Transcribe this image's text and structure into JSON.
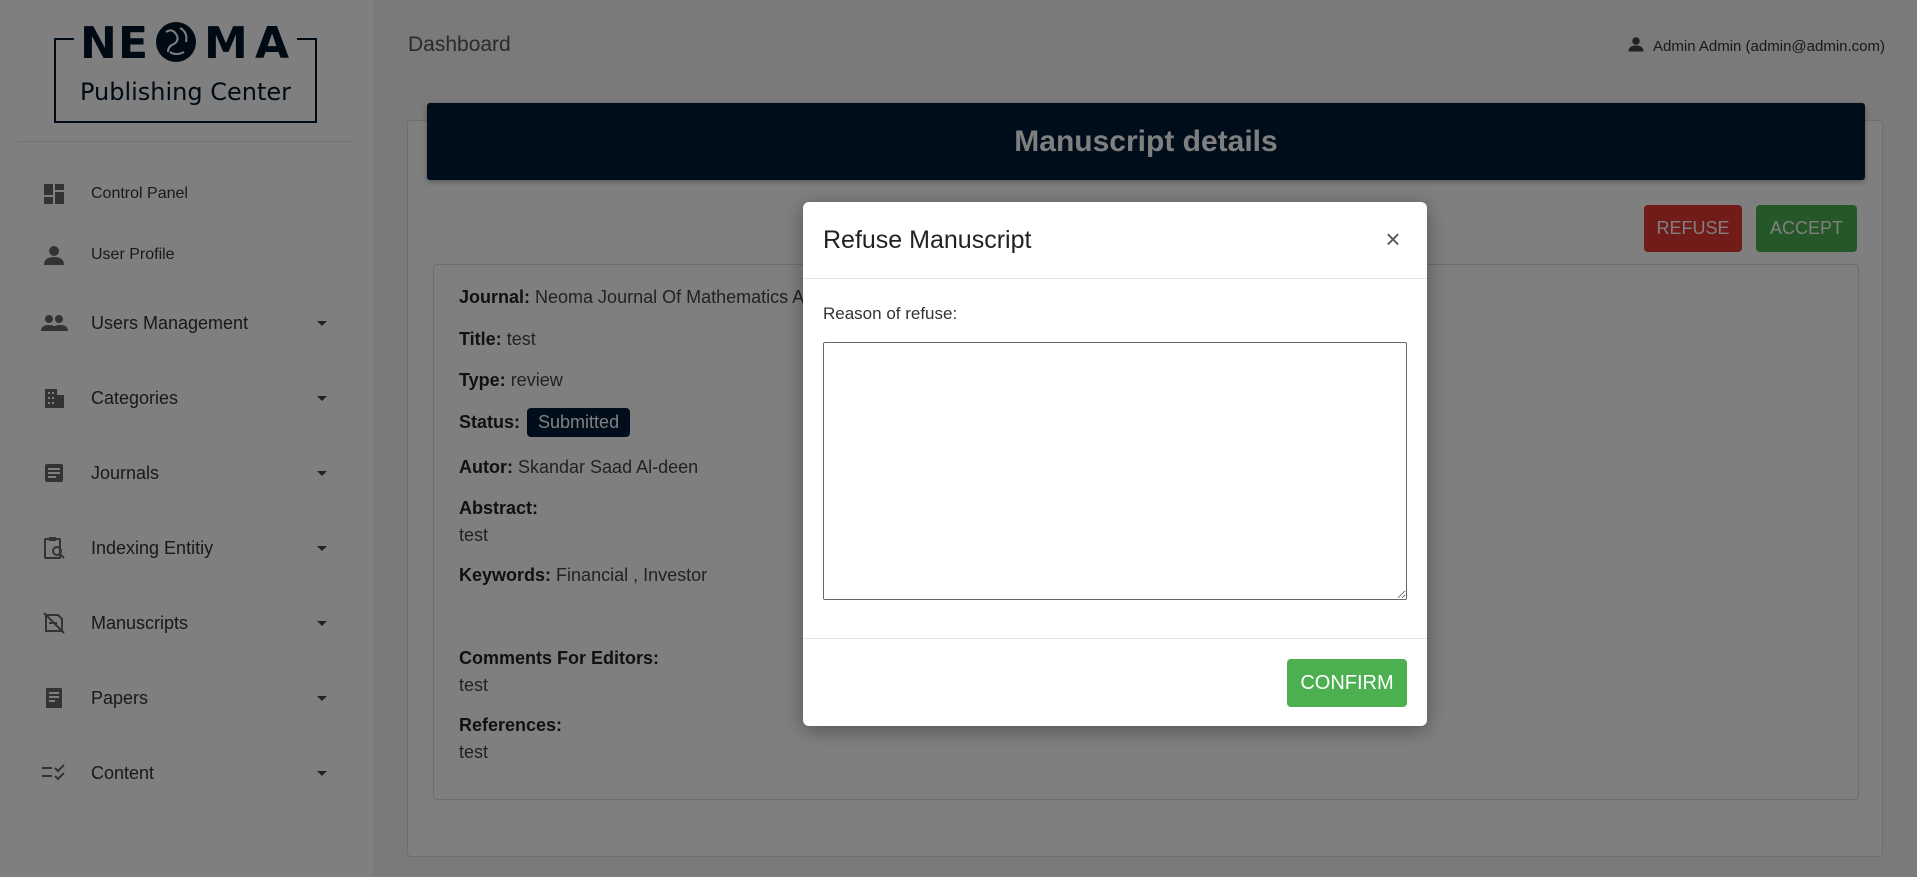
{
  "brand": {
    "name": "NEOMA",
    "subtitle": "Publishing Center"
  },
  "sidebar": {
    "items": [
      {
        "label": "Control Panel",
        "icon": "dashboard-icon",
        "has_caret": false
      },
      {
        "label": "User Profile",
        "icon": "person-icon",
        "has_caret": false
      },
      {
        "label": "Users Management",
        "icon": "group-icon",
        "has_caret": true
      },
      {
        "label": "Categories",
        "icon": "building-icon",
        "has_caret": true
      },
      {
        "label": "Journals",
        "icon": "article-icon",
        "has_caret": true
      },
      {
        "label": "Indexing Entitiy",
        "icon": "clipboard-search-icon",
        "has_caret": true
      },
      {
        "label": "Manuscripts",
        "icon": "manuscript-icon",
        "has_caret": true
      },
      {
        "label": "Papers",
        "icon": "paper-icon",
        "has_caret": true
      },
      {
        "label": "Content",
        "icon": "checklist-icon",
        "has_caret": true
      }
    ]
  },
  "header": {
    "title": "Dashboard",
    "user": "Admin Admin (admin@admin.com)"
  },
  "details": {
    "heading": "Manuscript details",
    "refuse_label": "REFUSE",
    "accept_label": "ACCEPT",
    "journal_label": "Journal:",
    "journal_value": "Neoma Journal Of Mathematics And",
    "title_label": "Title:",
    "title_value": "test",
    "type_label": "Type:",
    "type_value": "review",
    "status_label": "Status:",
    "status_value": "Submitted",
    "author_label": "Autor:",
    "author_value": "Skandar Saad Al-deen",
    "abstract_label": "Abstract:",
    "abstract_value": "test",
    "keywords_label": "Keywords:",
    "keywords_value": "Financial , Investor",
    "comments_label": "Comments For Editors:",
    "comments_value": "test",
    "references_label": "References:",
    "references_value": "test"
  },
  "modal": {
    "title": "Refuse Manuscript",
    "close_glyph": "×",
    "reason_label": "Reason of refuse:",
    "reason_value": "",
    "confirm_label": "CONFIRM"
  },
  "colors": {
    "navy": "#001a35",
    "refuse": "#e53935",
    "accept": "#4caf50"
  }
}
